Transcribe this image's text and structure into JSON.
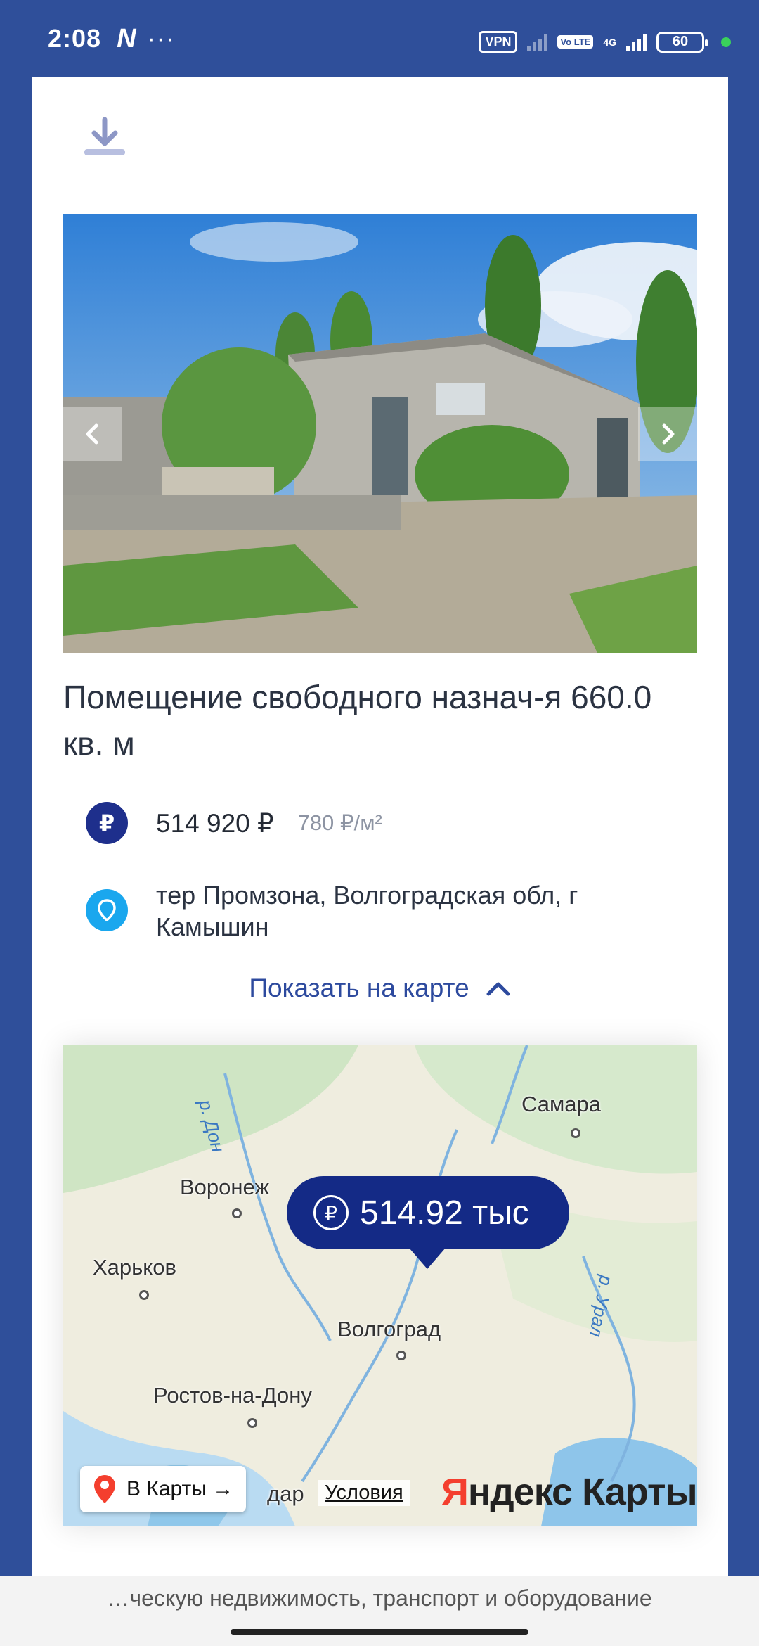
{
  "status_bar": {
    "time": "2:08",
    "network_letter": "N",
    "more": "···",
    "vpn": "VPN",
    "volte": "Vo LTE",
    "net_type": "4G",
    "battery": "60"
  },
  "listing": {
    "title": "Помещение свободного назнач-я 660.0 кв. м",
    "price": "514 920 ₽",
    "price_per_m2": "780 ₽/м²",
    "currency_symbol": "₽",
    "address": "тер Промзона, Волгоградская обл, г Камышин",
    "show_on_map": "Показать на карте"
  },
  "map": {
    "price_bubble": "514.92 тыс",
    "cities": {
      "samara": "Самара",
      "voronezh": "Воронеж",
      "kharkov": "Харьков",
      "volgograd": "Волгоград",
      "rostov": "Ростов-на-Дону",
      "krasnodar_partial": "дар"
    },
    "rivers": {
      "don": "р. Дон",
      "ural": "р. Урал"
    },
    "to_maps_button": "В Карты →",
    "terms_link": "Условия",
    "logo_ya": "Я",
    "logo_rest": "ндекс Карты"
  },
  "footer": {
    "text": "…ческую недвижимость, транспорт и оборудование"
  },
  "colors": {
    "background": "#2f4f9a",
    "accent": "#1e2f8c",
    "link": "#2d4a9e",
    "pin": "#1aa7ee"
  }
}
